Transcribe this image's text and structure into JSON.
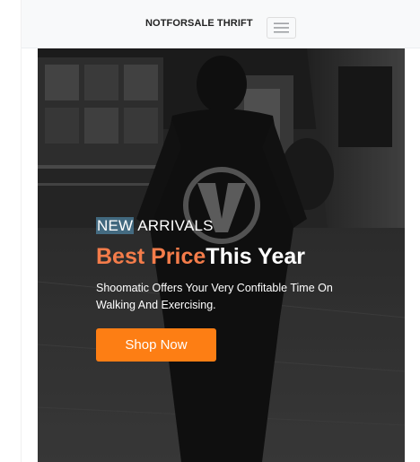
{
  "navbar": {
    "brand": "NOTFORSALE THRIFT",
    "toggler_icon": "hamburger-icon"
  },
  "hero": {
    "eyebrow_highlight": "NEW",
    "eyebrow_rest": " ARRIVALS",
    "headline_accent": "Best Price",
    "headline_rest": "This Year",
    "subtext": "Shoomatic Offers Your Very Confitable Time On Walking And Exercising.",
    "cta_label": "Shop Now",
    "colors": {
      "accent": "#f47c4a",
      "button": "#fd7e14",
      "highlight": "#5aa0c8"
    }
  }
}
